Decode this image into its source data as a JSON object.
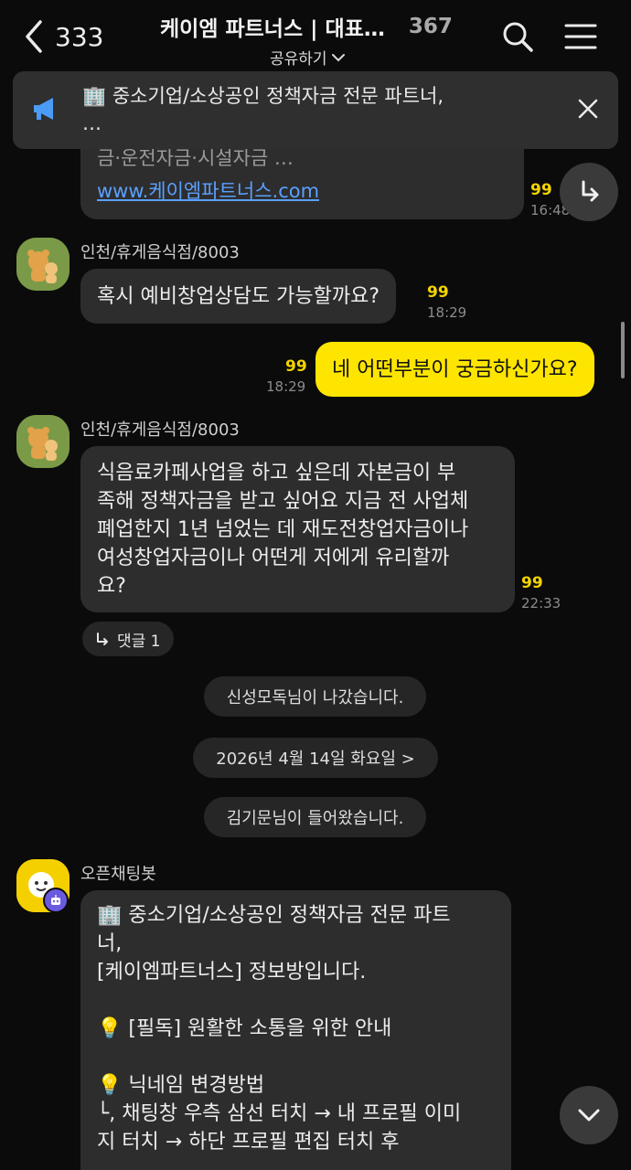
{
  "header": {
    "back_count": "333",
    "title": "케이엠 파트너스 | 대표…",
    "member_count": "367",
    "share_label": "공유하기"
  },
  "notice": {
    "text": "🏢 중소기업/소상공인 정책자금 전문 파트너,",
    "text_more": "…"
  },
  "messages": {
    "top_partial": {
      "line": "금·운전자금·시설자금 …",
      "link": "www.케이엠파트너스.com",
      "unread": "99",
      "time": "16:48"
    },
    "msg1": {
      "sender": "인천/휴게음식점/8003",
      "text": "혹시 예비창업상담도 가능할까요?",
      "unread": "99",
      "time": "18:29"
    },
    "msg2": {
      "text": "네 어떤부분이 궁금하신가요?",
      "unread": "99",
      "time": "18:29"
    },
    "msg3": {
      "sender": "인천/휴게음식점/8003",
      "lines": [
        "식음료카페사업을 하고 싶은데 자본금이 부",
        "족해 정책자금을 받고 싶어요 지금 전 사업체",
        "폐업한지 1년 넘었는 데 재도전창업자금이나",
        "여성창업자금이나 어떤게 저에게 유리할까",
        "요?"
      ],
      "unread": "99",
      "time": "22:33",
      "reply_label": "댓글 1"
    },
    "system": {
      "left": "신성모독님이 나갔습니다.",
      "date": "2026년 4월 14일 화요일 >",
      "joined": "김기문님이 들어왔습니다."
    },
    "bot": {
      "sender": "오픈채팅봇",
      "lines": [
        "🏢 중소기업/소상공인 정책자금 전문 파트",
        "너,",
        "[케이엠파트너스] 정보방입니다.",
        "",
        "💡 [필독] 원활한 소통을 위한 안내",
        "",
        "💡 닉네임 변경방법",
        "└, 채팅창 우측 삼선 터치 → 내 프로필 이미",
        "지 터치 → 하단 프로필 편집 터치 후"
      ]
    }
  },
  "colors": {
    "background": "#0b0b0b",
    "bubble_other": "#2d2d2d",
    "bubble_mine": "#fee500",
    "unread": "#f4d400",
    "link": "#5aa0ff"
  },
  "icons": [
    "back-chevron-icon",
    "search-icon",
    "menu-icon",
    "megaphone-icon",
    "close-icon",
    "reply-arrow-icon",
    "chevron-down-icon"
  ]
}
